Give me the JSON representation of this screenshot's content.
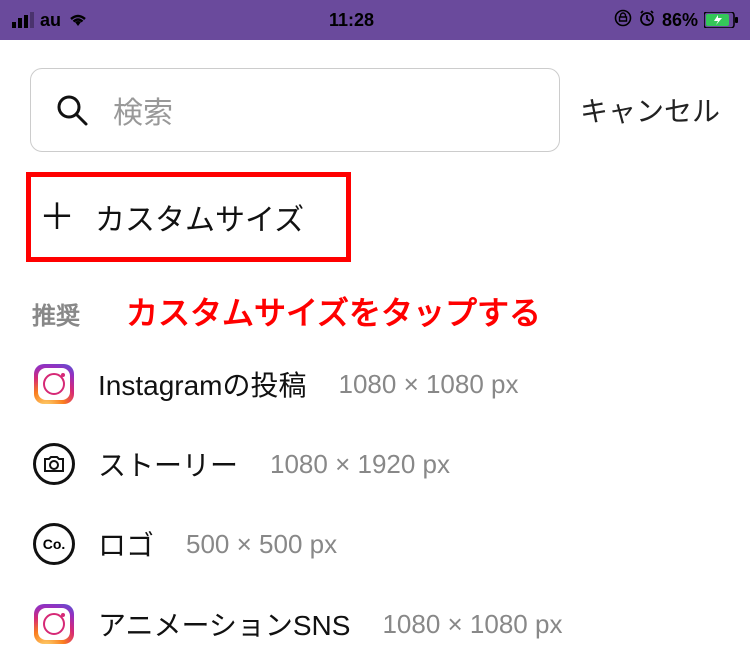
{
  "status": {
    "carrier": "au",
    "time": "11:28",
    "battery_pct": "86%"
  },
  "search": {
    "placeholder": "検索",
    "cancel_label": "キャンセル"
  },
  "custom_size": {
    "label": "カスタムサイズ"
  },
  "section": {
    "recommend_label": "推奨",
    "annotation": "カスタムサイズをタップする"
  },
  "items": [
    {
      "icon": "instagram",
      "label": "Instagramの投稿",
      "dims": "1080 × 1080 px"
    },
    {
      "icon": "camera",
      "label": "ストーリー",
      "dims": "1080 × 1920 px"
    },
    {
      "icon": "co",
      "label": "ロゴ",
      "dims": "500 × 500 px"
    },
    {
      "icon": "instagram",
      "label": "アニメーションSNS",
      "dims": "1080 × 1080 px"
    }
  ]
}
